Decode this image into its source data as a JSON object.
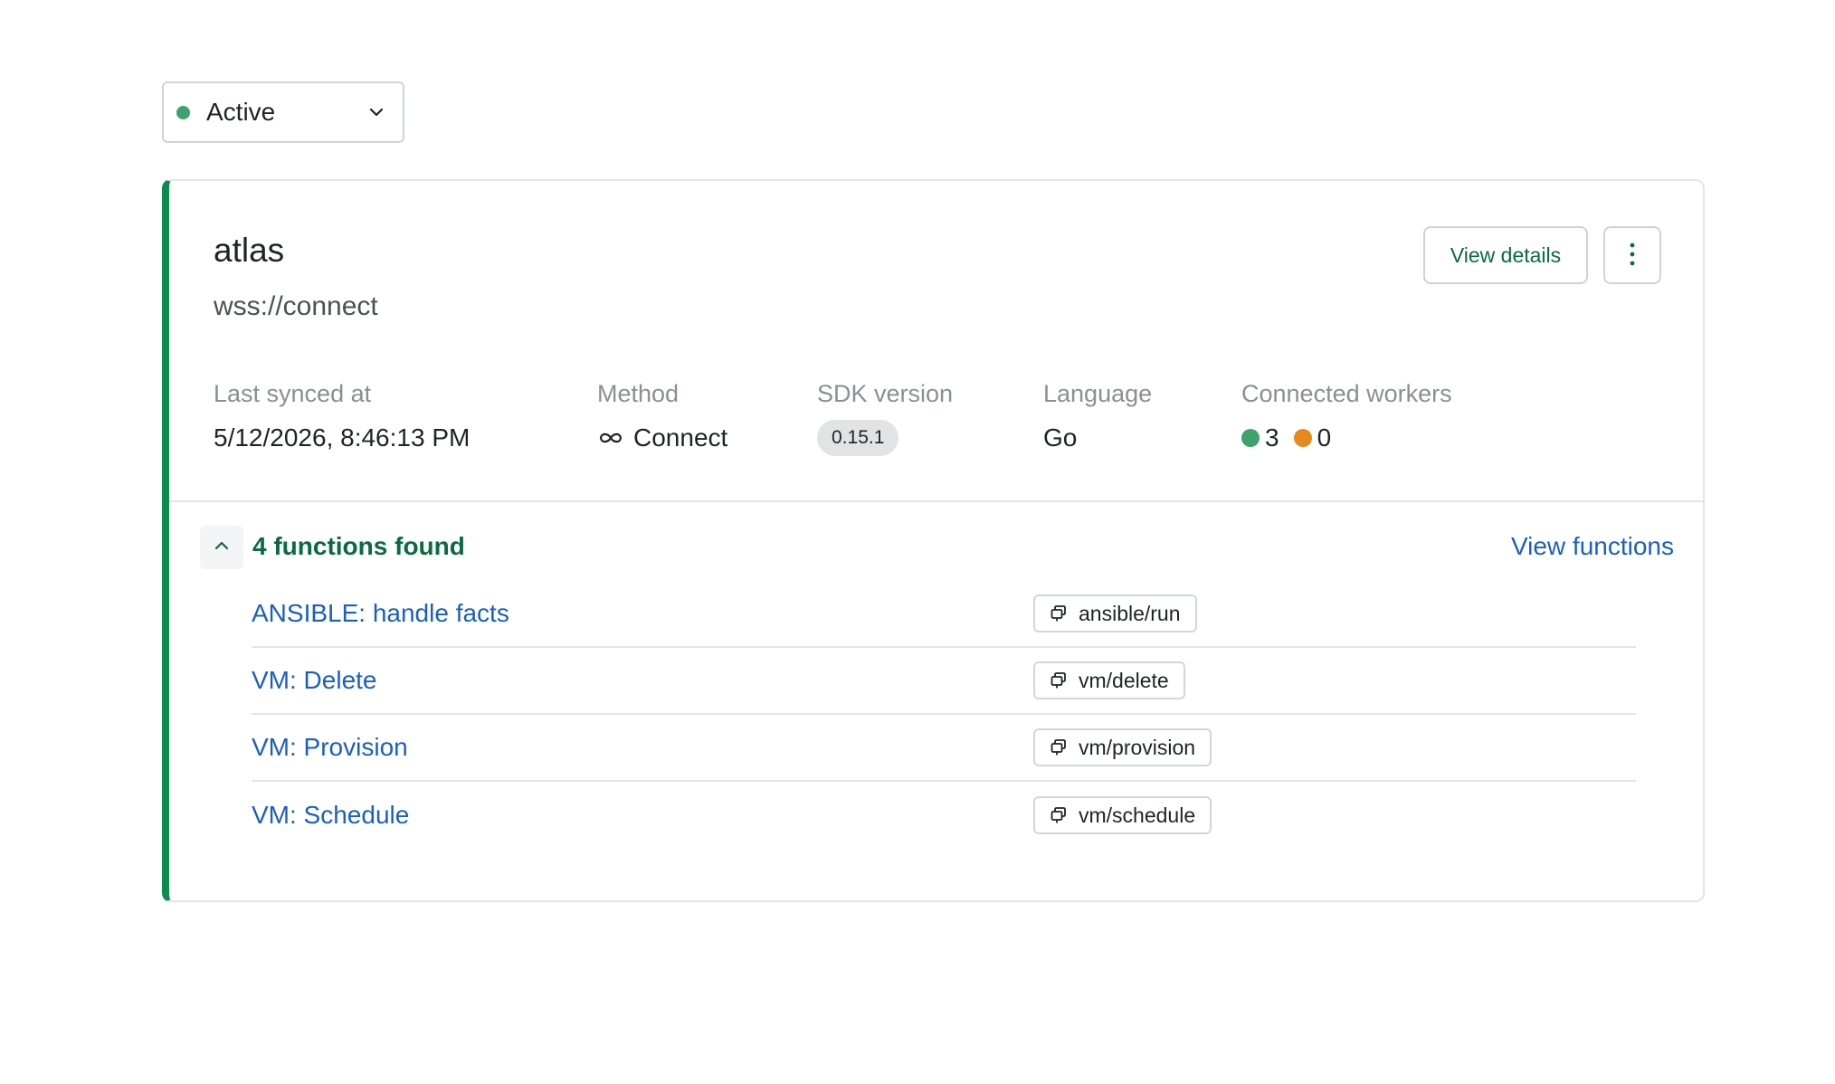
{
  "status_filter": {
    "label": "Active",
    "dot_color": "#3ea36a",
    "icon": "chevron-down-icon"
  },
  "app": {
    "name": "atlas",
    "url": "wss://connect",
    "accent_color": "#0c8a4f",
    "actions": {
      "view_details_label": "View details",
      "more_icon": "vertical-dots-icon"
    },
    "meta": {
      "last_synced": {
        "label": "Last synced at",
        "value": "5/12/2026, 8:46:13 PM"
      },
      "method": {
        "label": "Method",
        "value": "Connect",
        "icon": "infinity-icon"
      },
      "sdk_version": {
        "label": "SDK version",
        "value": "0.15.1"
      },
      "language": {
        "label": "Language",
        "value": "Go"
      },
      "connected_workers": {
        "label": "Connected workers",
        "healthy": "3",
        "healthy_color": "#3ea36a",
        "unhealthy": "0",
        "unhealthy_color": "#e58a1f"
      }
    }
  },
  "functions": {
    "count_label": "4 functions found",
    "view_label": "View functions",
    "toggle_icon": "chevron-up-icon",
    "items": [
      {
        "name": "ANSIBLE: handle facts",
        "slug": "ansible/run"
      },
      {
        "name": "VM: Delete",
        "slug": "vm/delete"
      },
      {
        "name": "VM: Provision",
        "slug": "vm/provision"
      },
      {
        "name": "VM: Schedule",
        "slug": "vm/schedule"
      }
    ]
  }
}
